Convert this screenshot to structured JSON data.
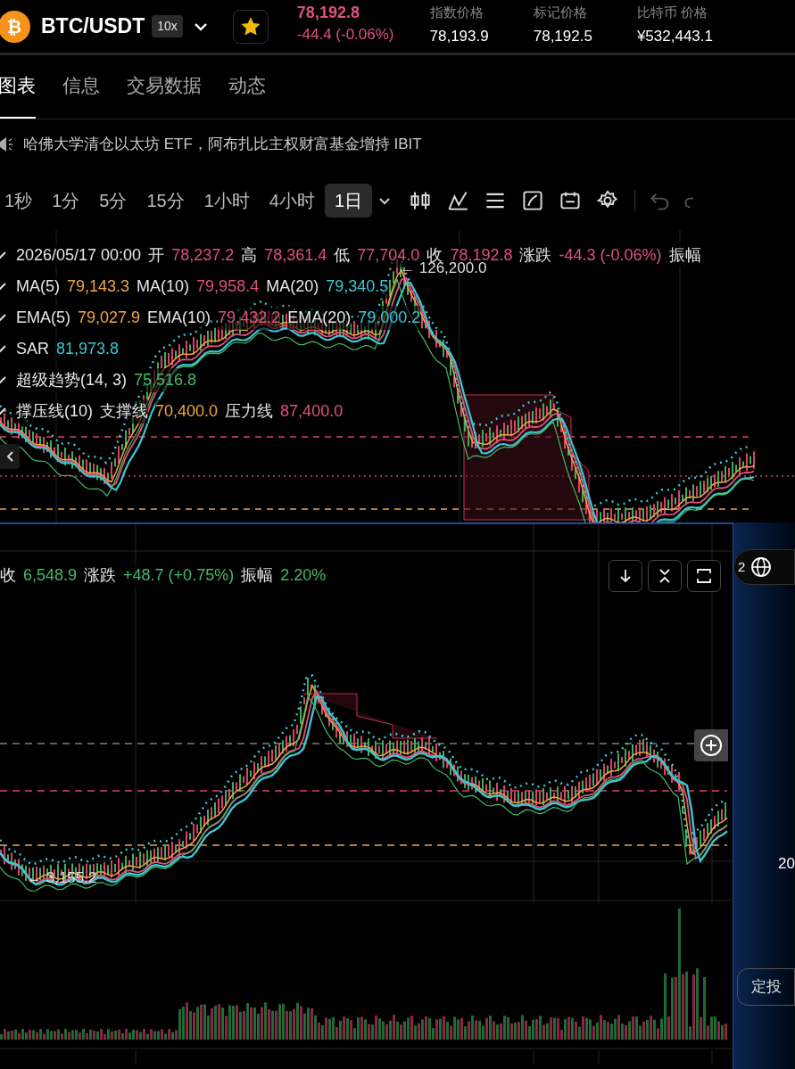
{
  "header": {
    "logo": "₿",
    "pair": "BTC/USDT",
    "leverage": "10x",
    "favorite": true,
    "last_price": "78,192.8",
    "change": "-44.4 (-0.06%)",
    "stats": [
      {
        "label": "指数价格",
        "value": "78,193.9"
      },
      {
        "label": "标记价格",
        "value": "78,192.5"
      },
      {
        "label": "比特币 价格",
        "value": "¥532,443.1"
      }
    ]
  },
  "tabs": [
    {
      "label": "图表",
      "selected": true
    },
    {
      "label": "信息",
      "selected": false
    },
    {
      "label": "交易数据",
      "selected": false
    },
    {
      "label": "动态",
      "selected": false
    }
  ],
  "news": "哈佛大学清仓以太坊 ETF，阿布扎比主权财富基金增持 IBIT",
  "intervals": [
    {
      "label": "1秒",
      "selected": false
    },
    {
      "label": "1分",
      "selected": false
    },
    {
      "label": "5分",
      "selected": false
    },
    {
      "label": "15分",
      "selected": false
    },
    {
      "label": "1小时",
      "selected": false
    },
    {
      "label": "4小时",
      "selected": false
    },
    {
      "label": "1日",
      "selected": true
    }
  ],
  "main_chart": {
    "legend": [
      [
        {
          "text": "2026/05/17 00:00",
          "kind": "label"
        },
        {
          "text": "开",
          "kind": "label"
        },
        {
          "text": "78,237.2",
          "kind": "value",
          "color": "#e0527a"
        },
        {
          "text": "高",
          "kind": "label"
        },
        {
          "text": "78,361.4",
          "kind": "value",
          "color": "#e0527a"
        },
        {
          "text": "低",
          "kind": "label"
        },
        {
          "text": "77,704.0",
          "kind": "value",
          "color": "#e0527a"
        },
        {
          "text": "收",
          "kind": "label"
        },
        {
          "text": "78,192.8",
          "kind": "value",
          "color": "#e0527a"
        },
        {
          "text": "涨跌",
          "kind": "label"
        },
        {
          "text": "-44.3 (-0.06%)",
          "kind": "value",
          "color": "#e0527a"
        },
        {
          "text": "振幅",
          "kind": "label"
        }
      ],
      [
        {
          "text": "MA(5)",
          "kind": "label"
        },
        {
          "text": "79,143.3",
          "kind": "value",
          "color": "#f0a646"
        },
        {
          "text": "MA(10)",
          "kind": "label"
        },
        {
          "text": "79,958.4",
          "kind": "value",
          "color": "#e0527a"
        },
        {
          "text": "MA(20)",
          "kind": "label"
        },
        {
          "text": "79,340.5",
          "kind": "value",
          "color": "#3cc6d3"
        }
      ],
      [
        {
          "text": "EMA(5)",
          "kind": "label"
        },
        {
          "text": "79,027.9",
          "kind": "value",
          "color": "#f0a646"
        },
        {
          "text": "EMA(10)",
          "kind": "label"
        },
        {
          "text": "79,432.2",
          "kind": "value",
          "color": "#e0527a"
        },
        {
          "text": "EMA(20)",
          "kind": "label"
        },
        {
          "text": "79,000.2",
          "kind": "value",
          "color": "#3cc6d3"
        }
      ],
      [
        {
          "text": "SAR",
          "kind": "label"
        },
        {
          "text": "81,973.8",
          "kind": "value",
          "color": "#3cc6d3"
        }
      ],
      [
        {
          "text": "超级趋势(14, 3)",
          "kind": "label"
        },
        {
          "text": "75,516.8",
          "kind": "value",
          "color": "#45b865"
        }
      ],
      [
        {
          "text": "撑压线(10)",
          "kind": "label"
        },
        {
          "text": "支撑线",
          "kind": "label"
        },
        {
          "text": "70,400.0",
          "kind": "value",
          "color": "#f0a646"
        },
        {
          "text": "压力线",
          "kind": "label"
        },
        {
          "text": "87,400.0",
          "kind": "value",
          "color": "#e0527a"
        }
      ]
    ],
    "high_marker": "← 126,200.0"
  },
  "second_chart": {
    "legend": [
      {
        "text": "收",
        "kind": "label"
      },
      {
        "text": "6,548.9",
        "kind": "value",
        "color": "#45b865"
      },
      {
        "text": "涨跌",
        "kind": "label"
      },
      {
        "text": "+48.7 (+0.75%)",
        "kind": "value",
        "color": "#45b865"
      },
      {
        "text": "振幅",
        "kind": "label"
      },
      {
        "text": "2.20%",
        "kind": "value",
        "color": "#45b865"
      }
    ],
    "low_marker": "← 3,155.2"
  },
  "side_panel": {
    "count": "2",
    "text": "20",
    "button": "定投"
  }
}
